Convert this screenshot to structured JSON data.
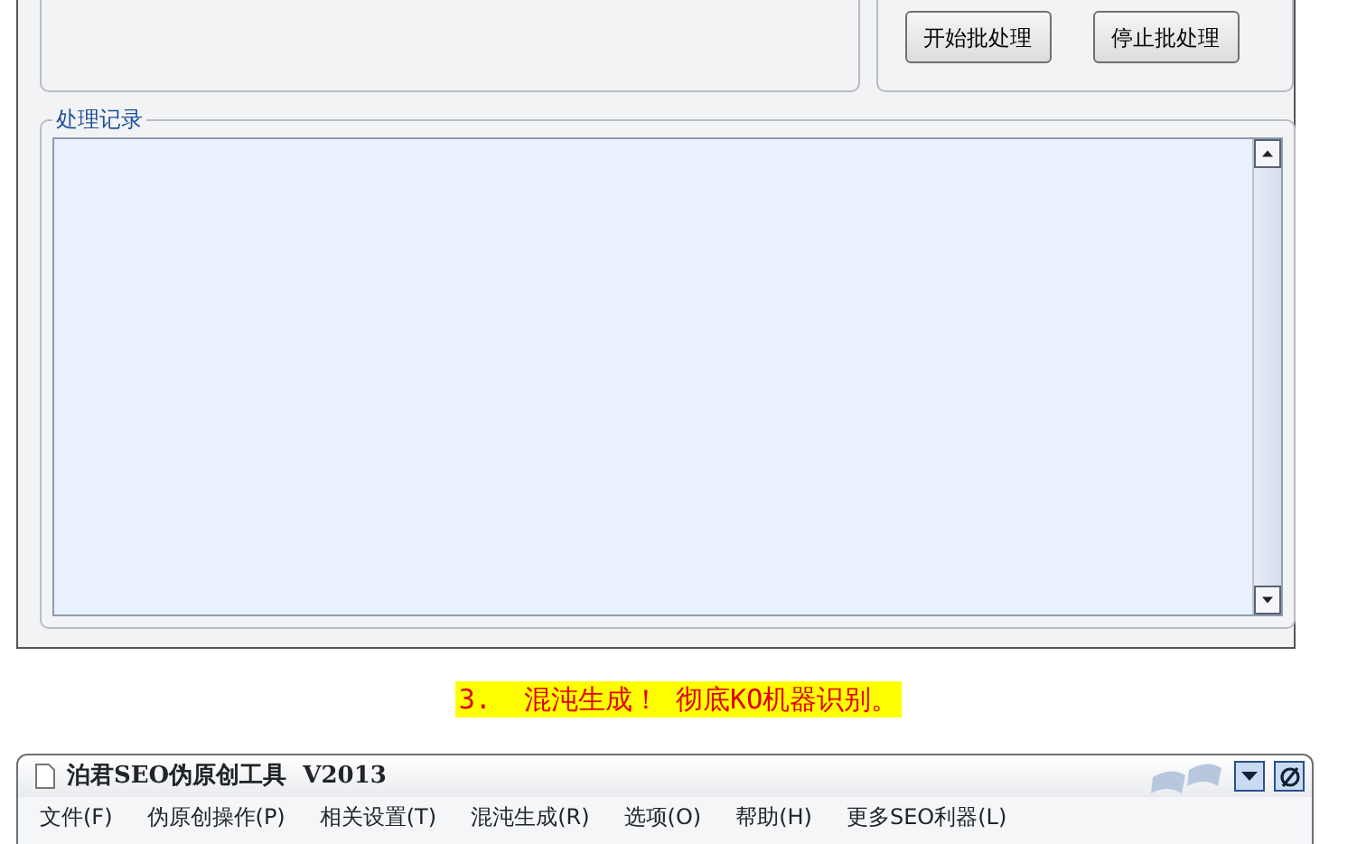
{
  "top_window": {
    "batch_buttons": [
      {
        "label": "开始批处理"
      },
      {
        "label": "停止批处理"
      }
    ],
    "log_panel": {
      "title": "处理记录"
    }
  },
  "caption": "3.  混沌生成！ 彻底KO机器识别。",
  "app_window": {
    "title": "泊君SEO伪原创工具  V2013",
    "menu": [
      {
        "label": "文件(F)"
      },
      {
        "label": "伪原创操作(P)"
      },
      {
        "label": "相关设置(T)"
      },
      {
        "label": "混沌生成(R)"
      },
      {
        "label": "选项(O)"
      },
      {
        "label": "帮助(H)"
      },
      {
        "label": "更多SEO利器(L)"
      }
    ]
  }
}
